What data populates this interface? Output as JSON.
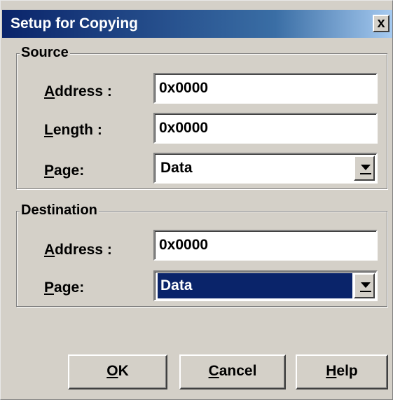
{
  "dialog": {
    "title": "Setup for Copying",
    "close_label": "x"
  },
  "source": {
    "group_title": "Source",
    "address_label": "Address :",
    "address_value": "0x0000",
    "length_label": "Length :",
    "length_value": "0x0000",
    "page_label": "Page:",
    "page_value": "Data"
  },
  "destination": {
    "group_title": "Destination",
    "address_label": "Address :",
    "address_value": "0x0000",
    "page_label": "Page:",
    "page_value": "Data"
  },
  "buttons": {
    "ok": "OK",
    "cancel": "Cancel",
    "help": "Help"
  }
}
